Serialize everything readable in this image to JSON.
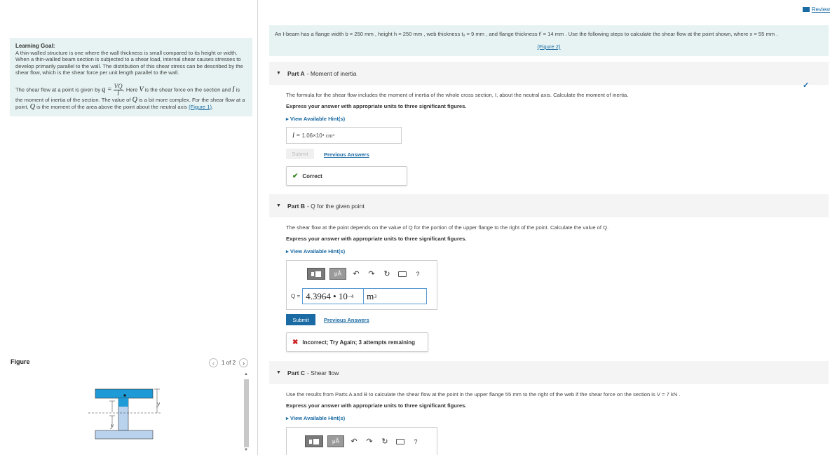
{
  "review": {
    "label": "Review"
  },
  "learning_goal": {
    "heading": "Learning Goal:",
    "p1": "A thin-walled structure is one where the wall thickness is small compared to its height or width. When a thin-walled beam section is subjected to a shear load, internal shear causes stresses to develop primarily parallel to the wall. The distribution of this shear stress can be described by the shear flow, which is the shear force per unit length parallel to the wall.",
    "p2_a": "The shear flow at a point is given by",
    "q_lhs": "q =",
    "frac_num": "VQ",
    "frac_den": "I",
    "p2_b": ". Here",
    "var_v": "V",
    "p2_c": "is the shear force on the section and",
    "var_i": "I",
    "p2_d": "is the moment of inertia of the section. The value of",
    "var_q": "Q",
    "p2_e": "is a bit more complex. For the shear flow at a point,",
    "p2_f": "is the moment of the area above the point about the neutral axis",
    "fig_link": "(Figure 1)",
    "end": "."
  },
  "figure": {
    "title": "Figure",
    "pager": "1 of 2",
    "label_y": "y",
    "label_y2": "y"
  },
  "intro": {
    "text": "An I-beam has a flange width b = 250 mm , height h = 250 mm , web thickness tᵤ = 9 mm , and flange thickness tᶠ = 14 mm . Use the following steps to calculate the shear flow at the point shown, where x = 55 mm .",
    "fig_link": "(Figure 2)"
  },
  "partA": {
    "label": "Part A",
    "title": "- Moment of inertia",
    "desc": "The formula for the shear flow includes the moment of inertia of the whole cross section, I, about the neutral axis. Calculate the moment of inertia.",
    "instr": "Express your answer with appropriate units to three significant figures.",
    "hint": "View Available Hint(s)",
    "answer_lhs": "I =",
    "answer_val": "1.06×10",
    "answer_exp": "4",
    "answer_unit": "cm",
    "answer_unit_exp": "4",
    "submit": "Submit",
    "prev": "Previous Answers",
    "feedback": "Correct"
  },
  "partB": {
    "label": "Part B",
    "title": "- Q for the given point",
    "desc": "The shear flow at the point depends on the value of Q for the portion of the upper flange to the right of the point. Calculate the value of Q.",
    "instr": "Express your answer with appropriate units to three significant figures.",
    "hint": "View Available Hint(s)",
    "toolbar_mu": "μÅ",
    "q_lhs": "Q =",
    "value": "4.3964 • 10",
    "exp": "−4",
    "unit": "m",
    "unit_exp": "3",
    "submit": "Submit",
    "prev": "Previous Answers",
    "feedback": "Incorrect; Try Again; 3 attempts remaining"
  },
  "partC": {
    "label": "Part C",
    "title": "- Shear flow",
    "desc": "Use the results from Parts A and B to calculate the shear flow at the point in the upper flange 55 mm to the right of the web if the shear force on the section is V = 7 kN .",
    "instr": "Express your answer with appropriate units to three significant figures.",
    "hint": "View Available Hint(s)",
    "toolbar_mu": "μÅ"
  }
}
